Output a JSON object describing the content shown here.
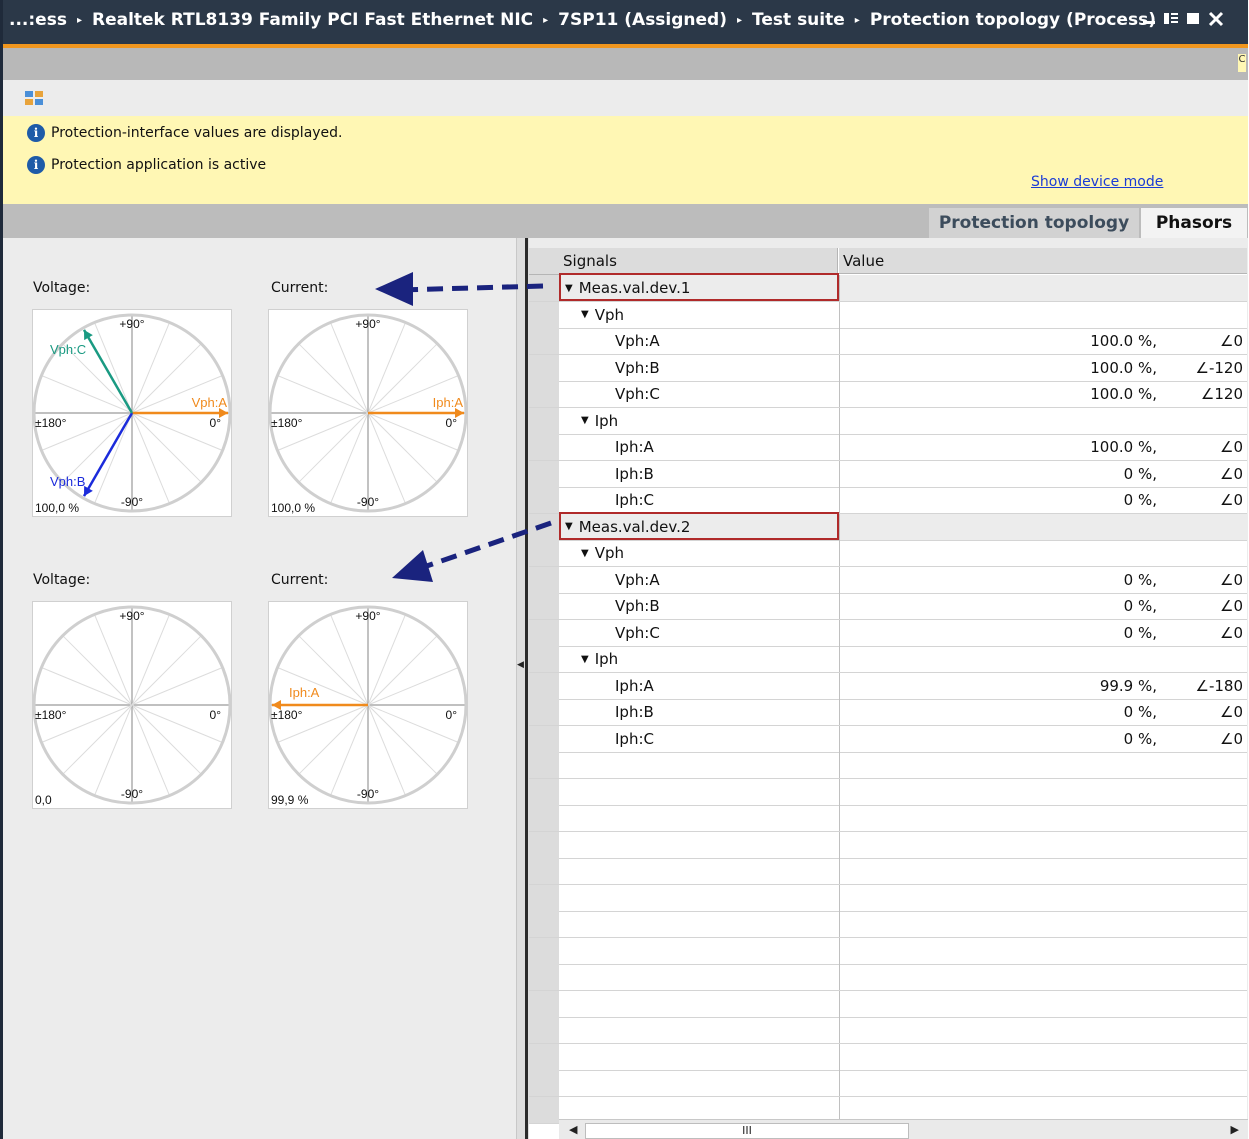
{
  "title_bar": {
    "crumbs": [
      "...:ess",
      "Realtek RTL8139 Family PCI Fast Ethernet NIC",
      "7SP11 (Assigned)",
      "Test suite",
      "Protection topology (Process)"
    ],
    "separator": "▸",
    "controls": [
      "minimize",
      "restore",
      "maximize",
      "close"
    ]
  },
  "toolbar": {
    "hint_letter": "C",
    "icon": "compare-icon"
  },
  "info": {
    "messages": [
      "Protection-interface values are displayed.",
      "Protection application is active"
    ],
    "show_device_mode": "Show device mode"
  },
  "tabs": [
    {
      "label": "Protection topology",
      "active": false
    },
    {
      "label": "Phasors",
      "active": true
    }
  ],
  "phasor_panels": [
    {
      "voltage": {
        "label": "Voltage:",
        "scale": "100,0 %",
        "arrows": [
          {
            "name": "Vph:A",
            "angle": 0,
            "color": "#f08a1c"
          },
          {
            "name": "Vph:B",
            "angle": -120,
            "color": "#1b2bdb"
          },
          {
            "name": "Vph:C",
            "angle": 120,
            "color": "#1a9a82"
          }
        ]
      },
      "current": {
        "label": "Current:",
        "scale": "100,0 %",
        "arrows": [
          {
            "name": "Iph:A",
            "angle": 0,
            "color": "#f08a1c"
          }
        ]
      }
    },
    {
      "voltage": {
        "label": "Voltage:",
        "scale": "0,0",
        "arrows": []
      },
      "current": {
        "label": "Current:",
        "scale": "99,9 %",
        "arrows": [
          {
            "name": "Iph:A",
            "angle": 180,
            "color": "#f08a1c"
          }
        ]
      }
    }
  ],
  "axis_labels": {
    "top": "+90°",
    "bottom": "-90°",
    "left": "±180°",
    "right": "0°"
  },
  "table": {
    "headers": [
      "Signals",
      "Value"
    ],
    "rows": [
      {
        "type": "group",
        "label": "Meas.val.dev.1"
      },
      {
        "type": "sub",
        "label": "Vph"
      },
      {
        "type": "item",
        "label": "Vph:A",
        "value": "100.0 %,",
        "angle": "∠0"
      },
      {
        "type": "item",
        "label": "Vph:B",
        "value": "100.0 %,",
        "angle": "∠-120"
      },
      {
        "type": "item",
        "label": "Vph:C",
        "value": "100.0 %,",
        "angle": "∠120"
      },
      {
        "type": "sub",
        "label": "Iph"
      },
      {
        "type": "item",
        "label": "Iph:A",
        "value": "100.0 %,",
        "angle": "∠0"
      },
      {
        "type": "item",
        "label": "Iph:B",
        "value": "0 %,",
        "angle": "∠0"
      },
      {
        "type": "item",
        "label": "Iph:C",
        "value": "0 %,",
        "angle": "∠0"
      },
      {
        "type": "group",
        "label": "Meas.val.dev.2"
      },
      {
        "type": "sub",
        "label": "Vph"
      },
      {
        "type": "item",
        "label": "Vph:A",
        "value": "0 %,",
        "angle": "∠0"
      },
      {
        "type": "item",
        "label": "Vph:B",
        "value": "0 %,",
        "angle": "∠0"
      },
      {
        "type": "item",
        "label": "Vph:C",
        "value": "0 %,",
        "angle": "∠0"
      },
      {
        "type": "sub",
        "label": "Iph"
      },
      {
        "type": "item",
        "label": "Iph:A",
        "value": "99.9 %,",
        "angle": "∠-180"
      },
      {
        "type": "item",
        "label": "Iph:B",
        "value": "0 %,",
        "angle": "∠0"
      },
      {
        "type": "item",
        "label": "Iph:C",
        "value": "0 %,",
        "angle": "∠0"
      }
    ],
    "scrollbar_grip": "III"
  },
  "colors": {
    "accent_orange": "#f0961e",
    "title_bg": "#2b3848",
    "info_bg": "#fff7b4",
    "highlight_red": "#b02a2a",
    "annotation_arrow": "#1a237e"
  }
}
